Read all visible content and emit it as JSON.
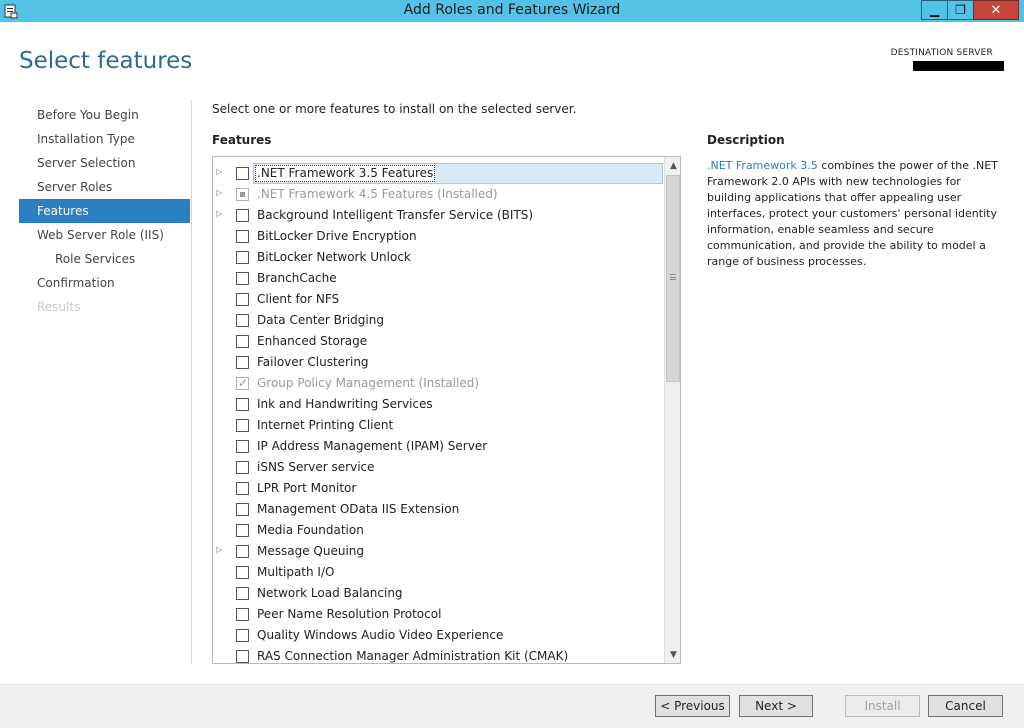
{
  "window": {
    "title": "Add Roles and Features Wizard",
    "minimize": "▁",
    "restore": "❐",
    "close": "✕"
  },
  "header": {
    "page_title": "Select features",
    "destination_label": "DESTINATION SERVER"
  },
  "nav": [
    {
      "label": "Before You Begin",
      "state": "normal"
    },
    {
      "label": "Installation Type",
      "state": "normal"
    },
    {
      "label": "Server Selection",
      "state": "normal"
    },
    {
      "label": "Server Roles",
      "state": "normal"
    },
    {
      "label": "Features",
      "state": "active"
    },
    {
      "label": "Web Server Role (IIS)",
      "state": "normal"
    },
    {
      "label": "Role Services",
      "state": "sub"
    },
    {
      "label": "Confirmation",
      "state": "normal"
    },
    {
      "label": "Results",
      "state": "disabled"
    }
  ],
  "main": {
    "instructions": "Select one or more features to install on the selected server.",
    "features_header": "Features"
  },
  "features": [
    {
      "label": ".NET Framework 3.5 Features",
      "expandable": true,
      "check": "unchecked",
      "selected": true
    },
    {
      "label": ".NET Framework 4.5 Features (Installed)",
      "expandable": true,
      "check": "partial",
      "disabled": true
    },
    {
      "label": "Background Intelligent Transfer Service (BITS)",
      "expandable": true,
      "check": "unchecked"
    },
    {
      "label": "BitLocker Drive Encryption",
      "check": "unchecked"
    },
    {
      "label": "BitLocker Network Unlock",
      "check": "unchecked"
    },
    {
      "label": "BranchCache",
      "check": "unchecked"
    },
    {
      "label": "Client for NFS",
      "check": "unchecked"
    },
    {
      "label": "Data Center Bridging",
      "check": "unchecked"
    },
    {
      "label": "Enhanced Storage",
      "check": "unchecked"
    },
    {
      "label": "Failover Clustering",
      "check": "unchecked"
    },
    {
      "label": "Group Policy Management (Installed)",
      "check": "checked",
      "disabled": true
    },
    {
      "label": "Ink and Handwriting Services",
      "check": "unchecked"
    },
    {
      "label": "Internet Printing Client",
      "check": "unchecked"
    },
    {
      "label": "IP Address Management (IPAM) Server",
      "check": "unchecked"
    },
    {
      "label": "iSNS Server service",
      "check": "unchecked"
    },
    {
      "label": "LPR Port Monitor",
      "check": "unchecked"
    },
    {
      "label": "Management OData IIS Extension",
      "check": "unchecked"
    },
    {
      "label": "Media Foundation",
      "check": "unchecked"
    },
    {
      "label": "Message Queuing",
      "expandable": true,
      "check": "unchecked"
    },
    {
      "label": "Multipath I/O",
      "check": "unchecked"
    },
    {
      "label": "Network Load Balancing",
      "check": "unchecked"
    },
    {
      "label": "Peer Name Resolution Protocol",
      "check": "unchecked"
    },
    {
      "label": "Quality Windows Audio Video Experience",
      "check": "unchecked"
    },
    {
      "label": "RAS Connection Manager Administration Kit (CMAK)",
      "check": "unchecked"
    }
  ],
  "description": {
    "header": "Description",
    "link_text": ".NET Framework 3.5",
    "body": " combines the power of the .NET Framework 2.0 APIs with new technologies for building applications that offer appealing user interfaces, protect your customers' personal identity information, enable seamless and secure communication, and provide the ability to model a range of business processes."
  },
  "footer": {
    "previous": "< Previous",
    "next": "Next >",
    "install": "Install",
    "cancel": "Cancel"
  },
  "colors": {
    "titlebar": "#52c3e6",
    "accent": "#2a7fc1",
    "close_button": "#c7463c"
  }
}
